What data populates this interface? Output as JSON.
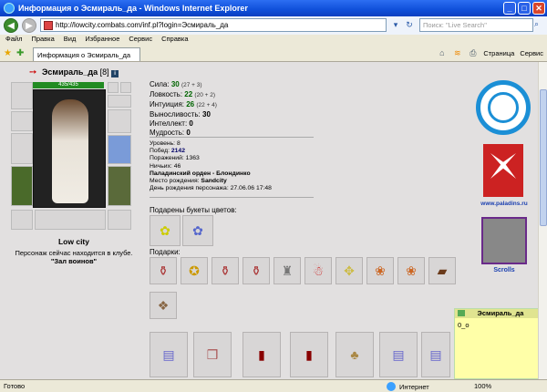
{
  "window": {
    "title": "Информация о Эсмираль_да - Windows Internet Explorer",
    "minimize": "_",
    "maximize": "□",
    "close": "✕"
  },
  "address": {
    "url": "http://lowcity.combats.com/inf.pl?login=Эсмираль_да"
  },
  "search": {
    "placeholder": "Поиск: \"Live Search\""
  },
  "menu": [
    "Файл",
    "Правка",
    "Вид",
    "Избранное",
    "Сервис",
    "Справка"
  ],
  "tab": {
    "label": "Информация о Эсмираль_да"
  },
  "command_bar": {
    "page": "Страница",
    "tools": "Сервис"
  },
  "character": {
    "name": "Эсмираль_да",
    "level": "[8]",
    "hp": "435/435",
    "location_city": "Low city",
    "location_text": "Персонаж сейчас находится в клубе.",
    "location_room": "\"Зал воинов\""
  },
  "stats": [
    {
      "label": "Сила:",
      "value": "30",
      "bonus": "(27 + 3)"
    },
    {
      "label": "Ловкость:",
      "value": "22",
      "bonus": "(20 + 2)"
    },
    {
      "label": "Интуиция:",
      "value": "26",
      "bonus": "(22 + 4)"
    },
    {
      "label": "Выносливость:",
      "value": "30",
      "bonus": ""
    },
    {
      "label": "Интеллект:",
      "value": "0",
      "bonus": ""
    },
    {
      "label": "Мудрость:",
      "value": "0",
      "bonus": ""
    }
  ],
  "info": {
    "level": "Уровень: 8",
    "wins_label": "Побед:",
    "wins": "2142",
    "losses": "Поражений: 1363",
    "draws": "Ничьих: 46",
    "order": "Паладинский орден - Блондинко",
    "birthplace_label": "Место рождения:",
    "birthplace": "Sandcity",
    "birthday": "День рождения персонажа: 27.06.06 17:48"
  },
  "sections": {
    "flowers": "Подарены букеты цветов:",
    "gifts": "Подарки:"
  },
  "right": {
    "link1": "www.paladins.ru",
    "link2": "Scrolls"
  },
  "note": {
    "title": "Эсмираль_да",
    "text": "0_o"
  },
  "status": {
    "left": "Готово",
    "zone": "Интернет",
    "zoom": "100%"
  },
  "colors": {
    "stat_value": "#006400",
    "paladin_blue": "#1b8fd6",
    "paladin_red": "#cc2222",
    "note_bg": "#ffffa8"
  }
}
